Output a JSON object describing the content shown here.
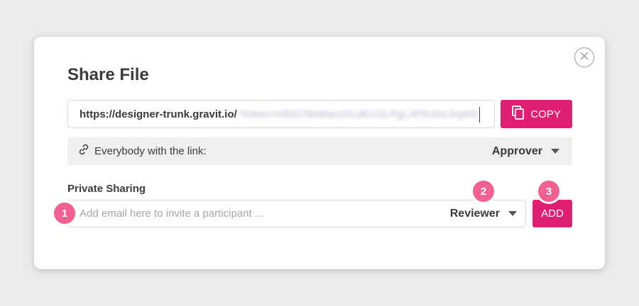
{
  "dialog": {
    "title": "Share File",
    "close_icon": "close-circle-icon"
  },
  "share_link": {
    "url_visible": "https://designer-trunk.gravit.io/",
    "url_obscured": "?token=HfsS7MxBacvSL0E1GLPgLXPbnDsJnpKb",
    "copy_label": "COPY",
    "copy_icon": "copy-icon"
  },
  "link_access": {
    "icon": "link-icon",
    "label": "Everybody with the link:",
    "role": "Approver"
  },
  "private_sharing": {
    "label": "Private Sharing",
    "email_placeholder": "Add email here to invite a participant ...",
    "email_value": "",
    "role": "Reviewer",
    "add_label": "ADD"
  },
  "badges": [
    "1",
    "2",
    "3"
  ],
  "colors": {
    "accent": "#e01f72",
    "badge": "#f0618f",
    "background": "#ebebeb"
  }
}
